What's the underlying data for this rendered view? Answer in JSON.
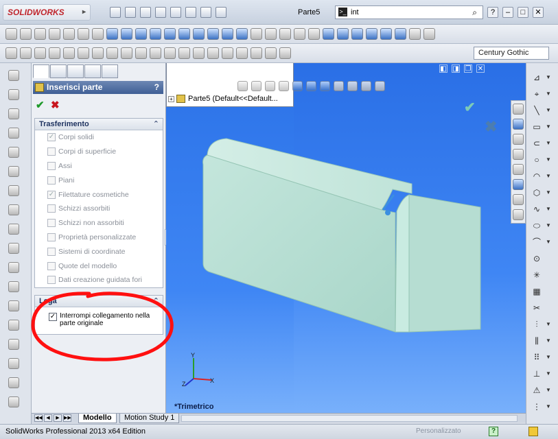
{
  "app": {
    "logo_text": "SOLIDWORKS",
    "logo_chevron": "▸",
    "document_title": "Parte5",
    "search_value": "int",
    "search_icon_glyph": ">_",
    "search_magnifier": "⌕",
    "help_glyph": "?",
    "window_controls": [
      "–",
      "□",
      "✕"
    ]
  },
  "toolbar": {
    "font_box": "Century Gothic"
  },
  "property_manager": {
    "title": "Inserisci parte",
    "help": "?",
    "ok_glyph": "✔",
    "cancel_glyph": "✖",
    "transfer": {
      "heading": "Trasferimento",
      "collapse_glyph": "⌃",
      "items": [
        {
          "label": "Corpi solidi",
          "checked": true
        },
        {
          "label": "Corpi di superficie",
          "checked": false
        },
        {
          "label": "Assi",
          "checked": false
        },
        {
          "label": "Piani",
          "checked": false
        },
        {
          "label": "Filettature cosmetiche",
          "checked": true
        },
        {
          "label": "Schizzi assorbiti",
          "checked": false
        },
        {
          "label": "Schizzi non assorbiti",
          "checked": false
        },
        {
          "label": "Proprietà personalizzate",
          "checked": false
        },
        {
          "label": "Sistemi di coordinate",
          "checked": false
        },
        {
          "label": "Quote del modello",
          "checked": false
        },
        {
          "label": "Dati creazione guidata fori",
          "checked": false
        }
      ]
    },
    "link": {
      "heading": "Lega",
      "collapse_glyph": "⌃",
      "option": {
        "label": "Interrompi collegamento nella parte originale",
        "checked": true
      }
    },
    "splitter_glyph": "◂"
  },
  "tree": {
    "expand_glyph": "+",
    "item_label": "Parte5  (Default<<Default..."
  },
  "viewport": {
    "view_label": "*Trimetrico",
    "confirm_ok": "✔",
    "confirm_cancel": "✖",
    "window_controls": [
      "◧",
      "◨",
      "❐",
      "✕"
    ],
    "triad_axes": [
      "Y",
      "X",
      "Z"
    ]
  },
  "bottom_tabs": {
    "nav": [
      "◀◀",
      "◀",
      "▶",
      "▶▶"
    ],
    "tabs": [
      "Modello",
      "Motion Study 1"
    ]
  },
  "status": {
    "text": "SolidWorks Professional 2013 x64 Edition",
    "custom": "Personalizzato",
    "help": "?"
  },
  "colors": {
    "viewport_top": "#2a6fe6",
    "viewport_bottom": "#78b0fb",
    "model_face": "#b6ddd2",
    "annotation": "#ff1010",
    "panel_header": "#3f5f95"
  }
}
